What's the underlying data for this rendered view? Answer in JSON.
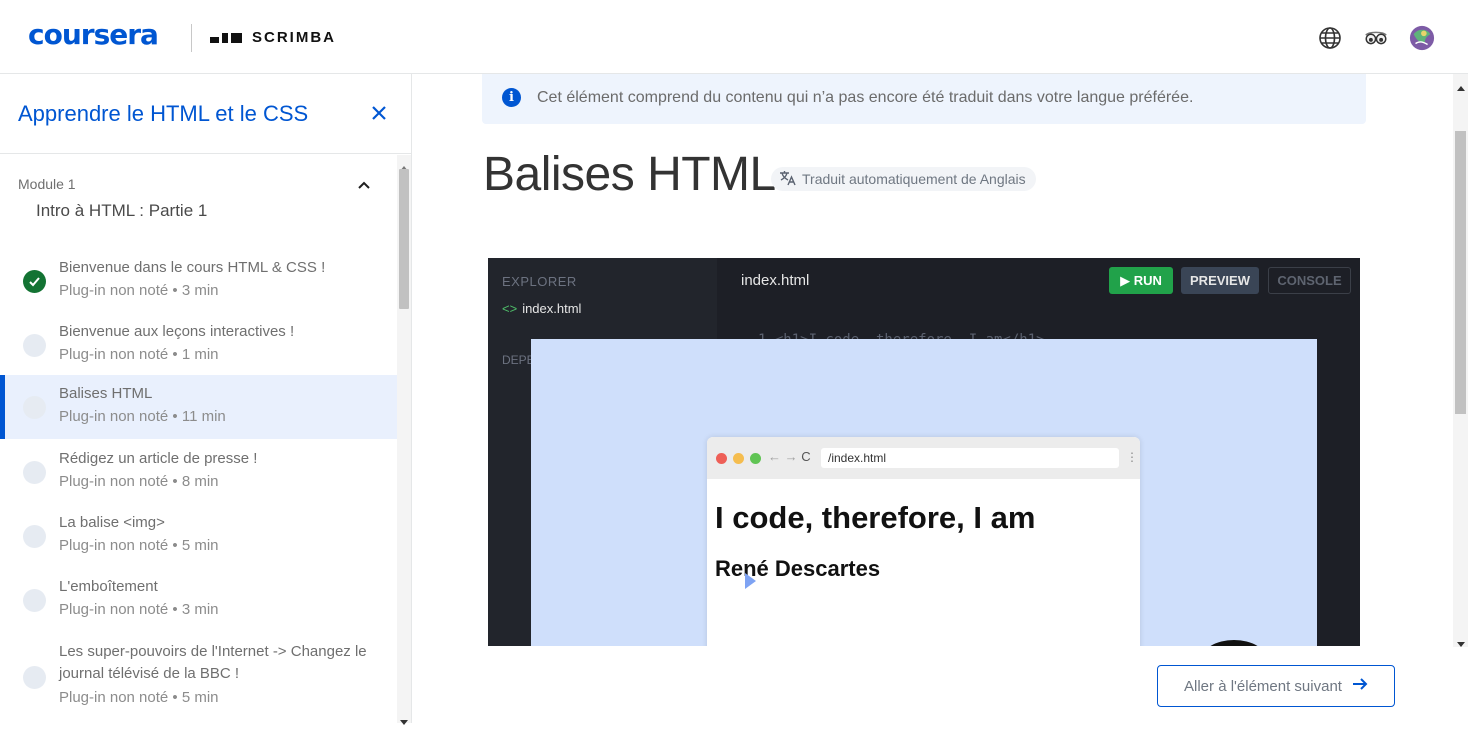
{
  "header": {
    "brand": "coursera",
    "partner": "SCRIMBA",
    "icons": [
      "globe-icon",
      "glasses-icon",
      "avatar"
    ]
  },
  "sidebar": {
    "course_title": "Apprendre le HTML et le CSS",
    "module_label": "Module 1",
    "module_name": "Intro à HTML : Partie 1",
    "items": [
      {
        "title": "Bienvenue dans le cours HTML & CSS !",
        "meta": "Plug-in non noté • 3 min",
        "status": "completed"
      },
      {
        "title": "Bienvenue aux leçons interactives !",
        "meta": "Plug-in non noté • 1 min",
        "status": "todo"
      },
      {
        "title": "Balises HTML",
        "meta": "Plug-in non noté • 11 min",
        "status": "active"
      },
      {
        "title": "Rédigez un article de presse !",
        "meta": "Plug-in non noté • 8 min",
        "status": "todo"
      },
      {
        "title": "La balise <img>",
        "meta": "Plug-in non noté • 5 min",
        "status": "todo"
      },
      {
        "title": "L'emboîtement",
        "meta": "Plug-in non noté • 3 min",
        "status": "todo"
      },
      {
        "title": "Les super-pouvoirs de l'Internet -> Changez le journal télévisé de la BBC !",
        "meta": "Plug-in non noté • 5 min",
        "status": "todo"
      }
    ]
  },
  "main": {
    "notice": "Cet élément comprend du contenu qui n’a pas encore été traduit dans votre langue préférée.",
    "lesson_title": "Balises HTML",
    "translate_badge": "Traduit automatiquement de Anglais",
    "next_button": "Aller à l'élément suivant"
  },
  "video": {
    "explorer_label": "EXPLORER",
    "file_name": "index.html",
    "dependencies_label": "DEPE",
    "editor_tab": "index.html",
    "run_label": "RUN",
    "preview_label": "PREVIEW",
    "console_label": "CONSOLE",
    "code_line": "1   <h1>I code, therefore, I am</h1>",
    "browser_url": "/index.html",
    "preview_h1": "I code, therefore, I am",
    "preview_h2": "René Descartes"
  },
  "colors": {
    "brand": "#0056d2",
    "completed": "#137333",
    "run": "#21a24a",
    "active_row": "#e9f0fd"
  }
}
